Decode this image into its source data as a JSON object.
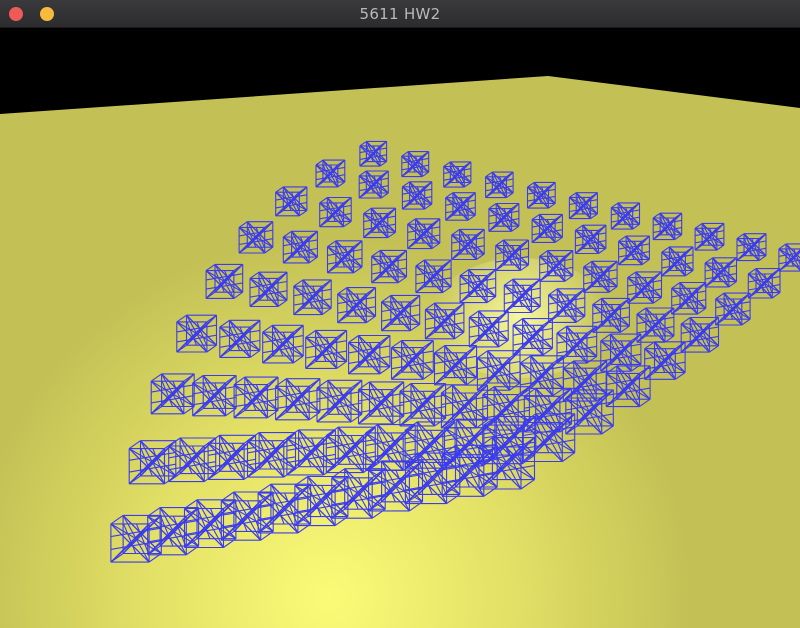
{
  "window": {
    "title": "5611 HW2",
    "controls": [
      {
        "name": "close",
        "color": "#ee5a56"
      },
      {
        "name": "minimize",
        "color": "#f6bb3c"
      }
    ]
  },
  "scene": {
    "background_color": "#000000",
    "ground_color": "#c3c155",
    "highlight_color": "#fbfb7a",
    "cloth_color": "#3b3bf0",
    "description_objects": "cloth-grid-of-wireframe-cubes"
  }
}
